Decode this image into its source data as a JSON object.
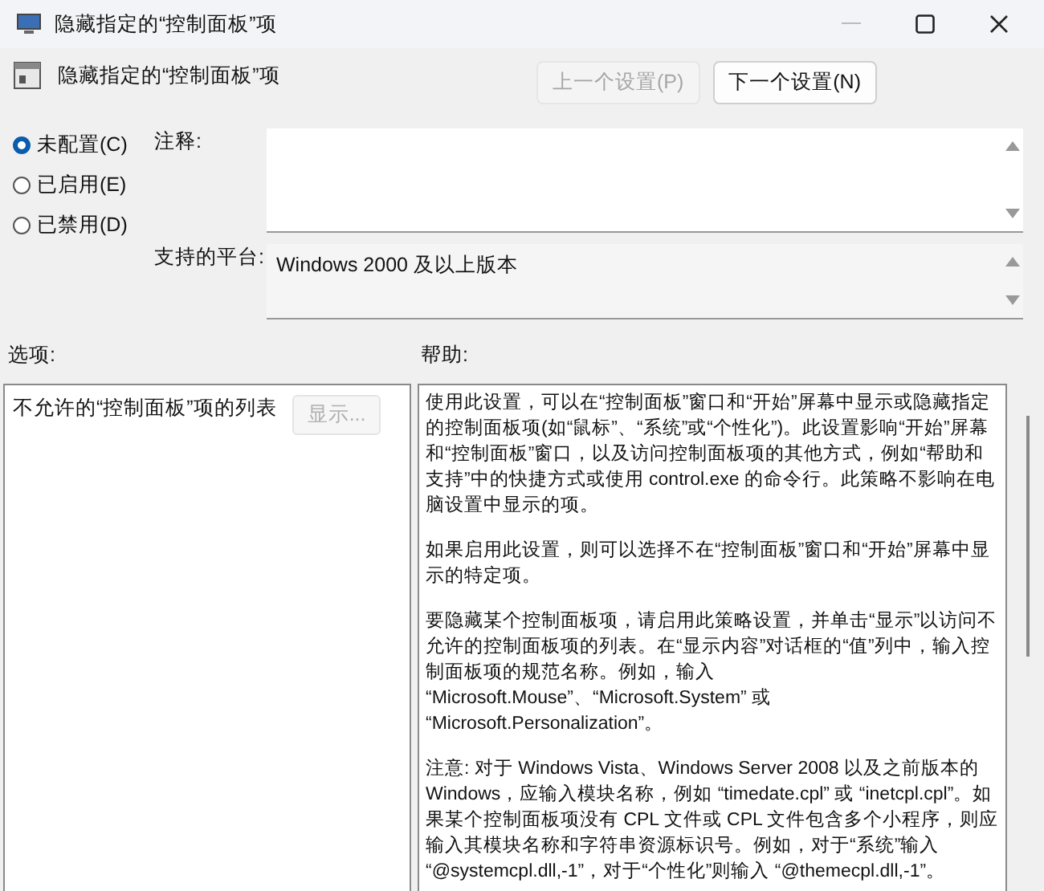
{
  "window": {
    "title": "隐藏指定的“控制面板”项"
  },
  "header": {
    "title": "隐藏指定的“控制面板”项",
    "buttons": [
      {
        "label": "上一个设置(P)",
        "disabled": true
      },
      {
        "label": "下一个设置(N)",
        "disabled": false
      }
    ]
  },
  "state_options": [
    {
      "label": "未配置(C)",
      "selected": true
    },
    {
      "label": "已启用(E)",
      "selected": false
    },
    {
      "label": "已禁用(D)",
      "selected": false
    }
  ],
  "comment": {
    "label": "注释:"
  },
  "platform": {
    "label": "支持的平台:",
    "value": "Windows 2000 及以上版本"
  },
  "options": {
    "label": "选项:",
    "list_label": "不允许的“控制面板”项的列表",
    "show_button": {
      "label": "显示...",
      "disabled": true
    }
  },
  "help": {
    "label": "帮助:",
    "paragraphs": [
      "使用此设置，可以在“控制面板”窗口和“开始”屏幕中显示或隐藏指定的控制面板项(如“鼠标”、“系统”或“个性化”)。此设置影响“开始”屏幕和“控制面板”窗口，以及访问控制面板项的其他方式，例如“帮助和支持”中的快捷方式或使用 control.exe 的命令行。此策略不影响在电脑设置中显示的项。",
      "如果启用此设置，则可以选择不在“控制面板”窗口和“开始”屏幕中显示的特定项。",
      "要隐藏某个控制面板项，请启用此策略设置，并单击“显示”以访问不允许的控制面板项的列表。在“显示内容”对话框的“值”列中，输入控制面板项的规范名称。例如，输入 “Microsoft.Mouse”、“Microsoft.System” 或 “Microsoft.Personalization”。",
      "注意: 对于 Windows Vista、Windows Server 2008 以及之前版本的 Windows，应输入模块名称，例如 “timedate.cpl” 或 “inetcpl.cpl”。如果某个控制面板项没有 CPL 文件或 CPL 文件包含多个小程序，则应输入其模块名称和字符串资源标识号。例如，对于“系统”输入 “@systemcpl.dll,-1”，对于“个性化”则输入 “@themecpl.dll,-1”。"
    ]
  }
}
